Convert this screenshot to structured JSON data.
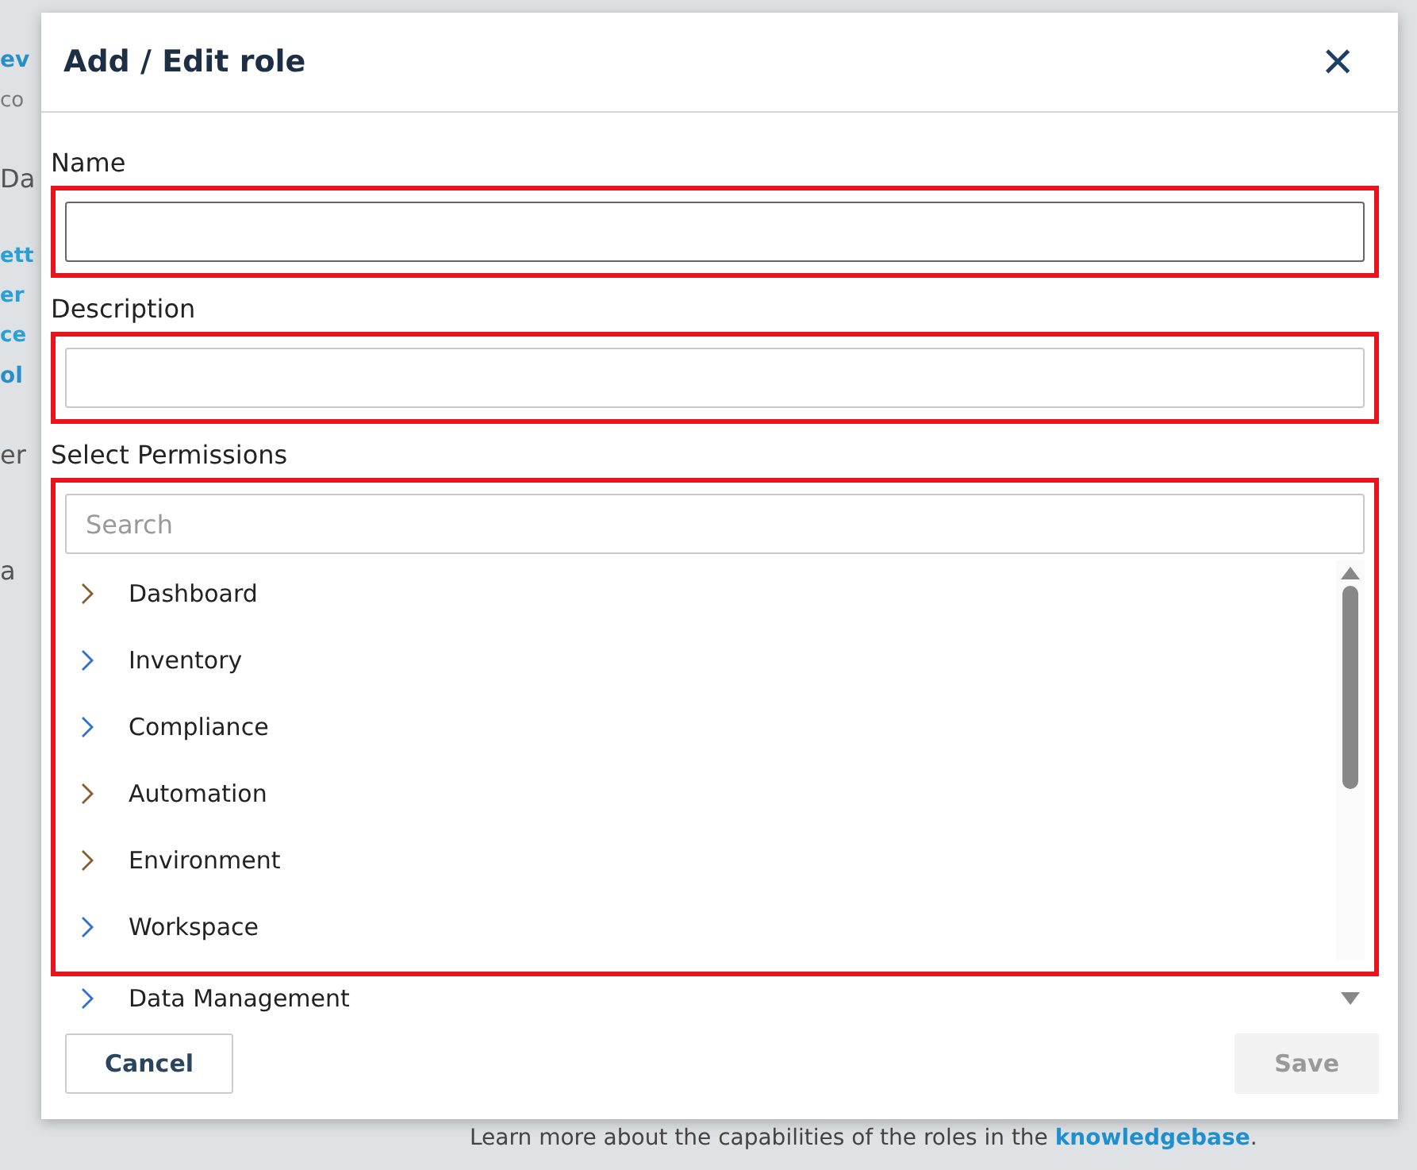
{
  "background": {
    "fragments": [
      {
        "text": "ev",
        "kind": "title"
      },
      {
        "text": "co",
        "kind": "muted"
      },
      {
        "text": "Da",
        "kind": "heading"
      },
      {
        "text": "ett",
        "kind": "link"
      },
      {
        "text": "er",
        "kind": "link"
      },
      {
        "text": "ce",
        "kind": "link"
      },
      {
        "text": "ol",
        "kind": "title"
      },
      {
        "text": "er",
        "kind": "heading"
      },
      {
        "text": "a",
        "kind": "heading"
      }
    ],
    "footer": {
      "text": "Learn more about the capabilities of the roles in the",
      "link": "knowledgebase",
      "after": "."
    }
  },
  "dialog": {
    "title": "Add / Edit role",
    "close": "×",
    "fields": [
      {
        "label": "Name",
        "highlighted": true,
        "focused": true
      },
      {
        "label": "Description",
        "highlighted": true,
        "focused": false
      }
    ],
    "permissions": {
      "label": "Select Permissions",
      "placeholder": "Search",
      "highlighted": true,
      "items": [
        {
          "label": "Dashboard",
          "color": "#8a5a2b"
        },
        {
          "label": "Inventory",
          "color": "#2a6fd6"
        },
        {
          "label": "Compliance",
          "color": "#2a6fd6"
        },
        {
          "label": "Automation",
          "color": "#8a5a2b"
        },
        {
          "label": "Environment",
          "color": "#8a5a2b"
        },
        {
          "label": "Workspace",
          "color": "#2a6fd6"
        }
      ],
      "more": [
        {
          "label": "Data Management",
          "color": "#2a6fd6"
        }
      ]
    },
    "buttons": [
      {
        "label": "Cancel",
        "kind": "secondary",
        "disabled": false
      },
      {
        "label": "Save",
        "kind": "primary",
        "disabled": true
      }
    ]
  }
}
